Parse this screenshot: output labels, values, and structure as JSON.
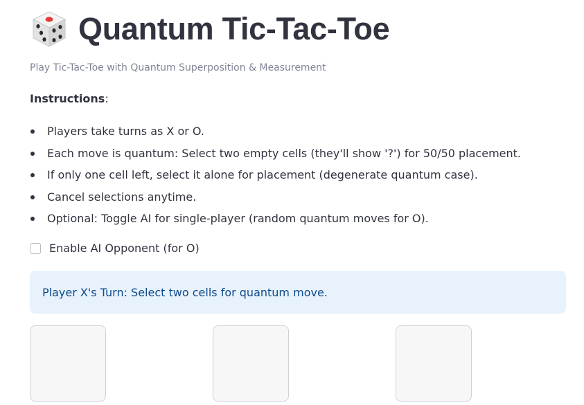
{
  "header": {
    "icon": "game-die",
    "title": "Quantum Tic-Tac-Toe",
    "subtitle": "Play Tic-Tac-Toe with Quantum Superposition & Measurement"
  },
  "instructions": {
    "heading": "Instructions",
    "heading_suffix": ":",
    "items": [
      "Players take turns as X or O.",
      "Each move is quantum: Select two empty cells (they'll show '?') for 50/50 placement.",
      "If only one cell left, select it alone for placement (degenerate quantum case).",
      "Cancel selections anytime.",
      "Optional: Toggle AI for single-player (random quantum moves for O)."
    ]
  },
  "ai_toggle": {
    "label": "Enable AI Opponent (for O)",
    "checked": false
  },
  "status": {
    "message": "Player X's Turn: Select two cells for quantum move."
  },
  "board": {
    "visible_cells": [
      "",
      "",
      ""
    ]
  },
  "colors": {
    "text": "#31333f",
    "subtitle": "#808495",
    "info_bg": "#e8f2fc",
    "info_text": "#0c4a8a",
    "cell_bg": "#f7f7f8",
    "cell_border": "#cfd1d6",
    "die_red": "#e53935"
  }
}
